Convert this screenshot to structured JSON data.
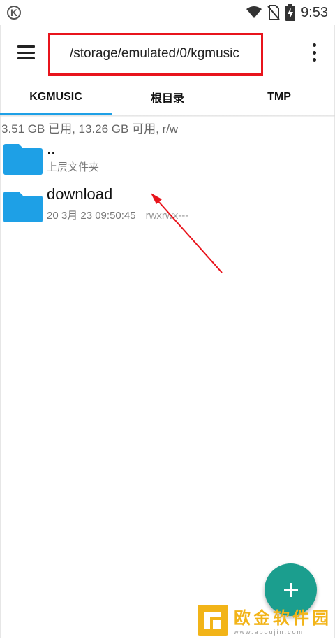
{
  "status_bar": {
    "time": "9:53"
  },
  "toolbar": {
    "path": "/storage/emulated/0/kgmusic"
  },
  "tabs": [
    {
      "label": "KGMUSIC",
      "active": true
    },
    {
      "label": "根目录",
      "active": false
    },
    {
      "label": "TMP",
      "active": false
    }
  ],
  "storage": {
    "info": "3.51 GB 已用, 13.26 GB 可用, r/w"
  },
  "files": [
    {
      "name": "..",
      "subtitle": "上层文件夹"
    },
    {
      "name": "download",
      "date": "20 3月 23 09:50:45",
      "permissions": "rwxrwx---"
    }
  ],
  "fab": {
    "icon": "plus-icon"
  },
  "watermark": {
    "title": "欧金软件园",
    "url": "www.apoujin.com"
  },
  "colors": {
    "accent": "#1ea0e6",
    "fab": "#1b9e8e",
    "highlight": "#e8141c",
    "folder": "#1ea0e6"
  }
}
